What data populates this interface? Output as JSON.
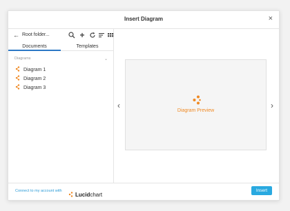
{
  "dialog": {
    "title": "Insert Diagram",
    "close": "×"
  },
  "toolbar": {
    "back": "←",
    "folder": "Root folder...",
    "search": "⌕",
    "add": "+",
    "refresh": "↻",
    "sort": "≡",
    "view": "⋮⋮"
  },
  "tabs": [
    {
      "label": "Documents",
      "active": true
    },
    {
      "label": "Templates",
      "active": false
    }
  ],
  "list": {
    "section": "Diagrams",
    "section_chevron": "⌄",
    "items": [
      {
        "label": "Diagram 1",
        "icon": "lucid-diagram-icon"
      },
      {
        "label": "Diagram 2",
        "icon": "lucid-diagram-icon"
      },
      {
        "label": "Diagram 3",
        "icon": "lucid-diagram-icon"
      }
    ]
  },
  "preview": {
    "label": "Diagram Preview",
    "prev_arrow": "‹",
    "next_arrow": "›"
  },
  "footer": {
    "connect": "Connect to my account with",
    "brand_bold": "Lucid",
    "brand_regular": "chart",
    "insert": "Insert"
  },
  "colors": {
    "accent": "#f08a24",
    "link": "#2b9bd7",
    "button": "#29a9e0",
    "tab_underline": "#2b78c5"
  }
}
